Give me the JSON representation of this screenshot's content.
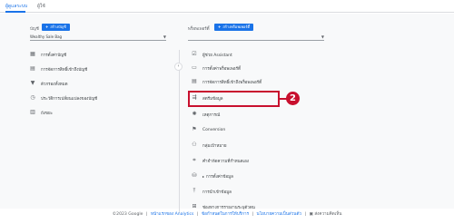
{
  "tabs": [
    {
      "label": "ผู้ดูแลระบบ",
      "active": true
    },
    {
      "label": "ผู้ใช้",
      "active": false
    }
  ],
  "account": {
    "label": "บัญชี",
    "create_label": "สร้างบัญชี",
    "selected": "Wealthy Sale Bag"
  },
  "property": {
    "label": "พร็อพเพอร์ตี้",
    "create_label": "สร้างพร็อพเพอร์ตี้",
    "selected": ""
  },
  "account_menu": [
    {
      "label": "การตั้งค่าบัญชี",
      "icon": "settings-grid-icon"
    },
    {
      "label": "การจัดการสิทธิ์เข้าถึงบัญชี",
      "icon": "people-icon"
    },
    {
      "label": "ตัวกรองทั้งหมด",
      "icon": "filter-icon"
    },
    {
      "label": "ประวัติการเปลี่ยนแปลงของบัญชี",
      "icon": "history-icon"
    },
    {
      "label": "ถังขยะ",
      "icon": "trash-icon"
    }
  ],
  "property_menu": [
    {
      "label": "ผู้ช่วย Assistant",
      "icon": "checkbox-icon"
    },
    {
      "label": "การตั้งค่าพร็อพเพอร์ตี้",
      "icon": "settings-icon"
    },
    {
      "label": "การจัดการสิทธิ์เข้าถึงพร็อพเพอร์ตี้",
      "icon": "people-icon"
    },
    {
      "label": "สตรีมข้อมูล",
      "icon": "data-stream-icon",
      "highlighted": true
    },
    {
      "label": "เหตุการณ์",
      "icon": "events-icon"
    },
    {
      "label": "Conversion",
      "icon": "flag-icon"
    },
    {
      "label": "กลุ่มเป้าหมาย",
      "icon": "audience-icon"
    },
    {
      "label": "คำจำกัดความที่กำหนดเอง",
      "icon": "custom-definitions-icon"
    },
    {
      "label": "การตั้งค่าข้อมูล",
      "icon": "database-icon",
      "expandable": true
    },
    {
      "label": "การนำเข้าข้อมูล",
      "icon": "upload-icon"
    },
    {
      "label": "ช่องทางการรายงานระบุตัวตน",
      "icon": "identity-icon"
    }
  ],
  "callout": {
    "number": "2",
    "color": "#c8102e"
  },
  "footer": {
    "copyright": "©2023 Google",
    "links": [
      "หน้าแรกของ Analytics",
      "ข้อกำหนดในการให้บริการ",
      "นโยบายความเป็นส่วนตัว"
    ],
    "feedback": "ส่งความคิดเห็น"
  },
  "colors": {
    "accent": "#1a73e8",
    "highlight": "#c8102e"
  }
}
